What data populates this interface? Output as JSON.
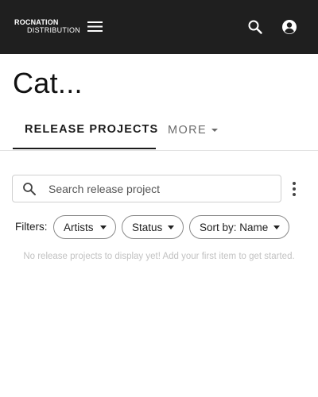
{
  "header": {
    "brand_line1": "ROCNATION",
    "brand_line2": "DISTRIBUTION",
    "menu_icon": "hamburger-menu-icon",
    "search_icon": "search-icon",
    "account_icon": "account-circle-icon",
    "background_color": "#1f1f1f"
  },
  "page": {
    "title": "Cat..."
  },
  "tabs": {
    "release_projects": "RELEASE PROJECTS",
    "more": "MORE"
  },
  "search": {
    "placeholder": "Search release project",
    "value": ""
  },
  "filters": {
    "label": "Filters:",
    "artists": "Artists",
    "status": "Status",
    "sort": "Sort by: Name"
  },
  "empty_state": {
    "message": "No release projects to display yet! Add your first item to get started."
  }
}
